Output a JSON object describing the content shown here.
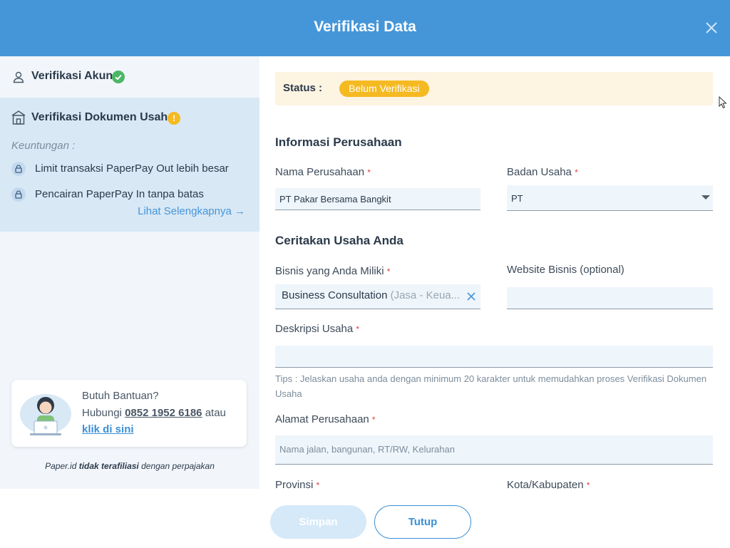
{
  "header": {
    "title": "Verifikasi Data"
  },
  "sidebar": {
    "akun_label": "Verifikasi Akun",
    "doc_label": "Verifikasi Dokumen Usaha",
    "warn_symbol": "!",
    "keuntungan": "Keuntungan :",
    "benefits": [
      "Limit transaksi PaperPay Out lebih besar",
      "Pencairan PaperPay In tanpa batas"
    ],
    "more_link": "Lihat Selengkapnya →",
    "help": {
      "title": "Butuh Bantuan?",
      "contact_prefix": "Hubungi",
      "phone": "0852 1952 6186",
      "contact_suffix": "atau",
      "link": "klik di sini"
    },
    "footer_note": {
      "brand": "Paper.id",
      "bold": "tidak terafiliasi",
      "rest": "dengan perpajakan"
    }
  },
  "status": {
    "label": "Status :",
    "badge": "Belum Verifikasi"
  },
  "company_section": {
    "title": "Informasi Perusahaan",
    "name_label": "Nama Perusahaan",
    "name_value": "PT Pakar Bersama Bangkit",
    "entity_label": "Badan Usaha",
    "entity_value": "PT"
  },
  "business_section": {
    "title": "Ceritakan Usaha Anda",
    "business_label": "Bisnis yang Anda Miliki",
    "business_chip_main": "Business Consultation",
    "business_chip_sub": " (Jasa - Keua...",
    "website_label": "Website Bisnis (optional)",
    "website_value": "",
    "desc_label": "Deskripsi Usaha",
    "desc_value": "",
    "tips": "Tips : Jelaskan usaha anda dengan minimum 20 karakter untuk memudahkan proses Verifikasi Dokumen Usaha",
    "address_label": "Alamat Perusahaan",
    "address_placeholder": "Nama jalan, bangunan, RT/RW, Kelurahan",
    "province_label": "Provinsi",
    "city_label": "Kota/Kabupaten"
  },
  "required_mark": "*",
  "buttons": {
    "save": "Simpan",
    "close": "Tutup"
  },
  "colors": {
    "header": "#4596d9",
    "accent": "#3a8fd6",
    "success": "#4cb766",
    "warning": "#f5b921",
    "sidebar_active": "#d8e8f5",
    "status_bg": "#fdf4e1"
  }
}
